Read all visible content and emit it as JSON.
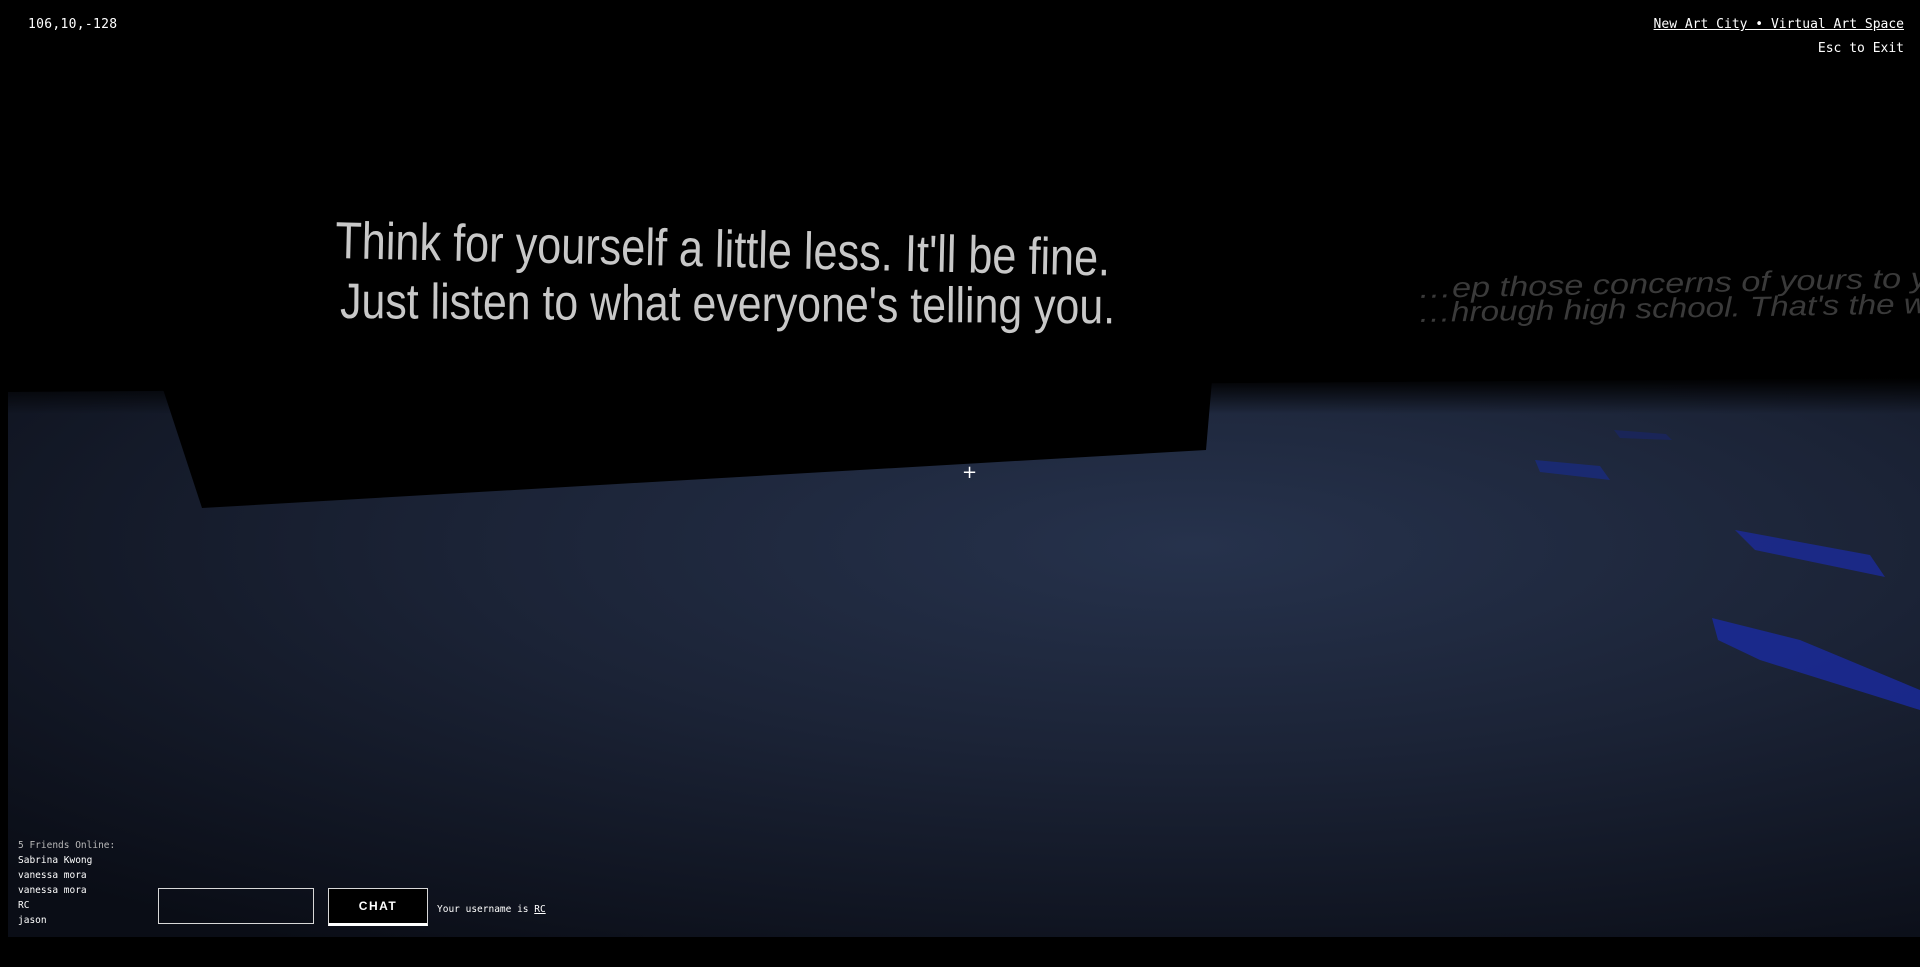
{
  "hud": {
    "coordinates": "106,10,-128",
    "site_title": "New Art City • Virtual Art Space",
    "exit_hint": "Esc to Exit",
    "crosshair": "+"
  },
  "artwork": {
    "main_text": {
      "line1": "Think for yourself a little less. It'll be fine.",
      "line2": "Just listen to what everyone's telling you."
    },
    "side_text": {
      "line1": "…ep those concerns of yours to y",
      "line2": "…hrough high school. That's the w"
    }
  },
  "friends": {
    "header": "5 Friends Online:",
    "list": [
      "Sabrina Kwong",
      "vanessa mora",
      "vanessa mora",
      "RC",
      "jason"
    ]
  },
  "chat": {
    "input_value": "",
    "input_placeholder": "",
    "button_label": "CHAT",
    "username_prefix": "Your username is",
    "username": "RC"
  },
  "colors": {
    "background": "#000000",
    "floor": "#1f2a40",
    "floor_accent": "#1a2a8a",
    "text": "#ffffff"
  }
}
